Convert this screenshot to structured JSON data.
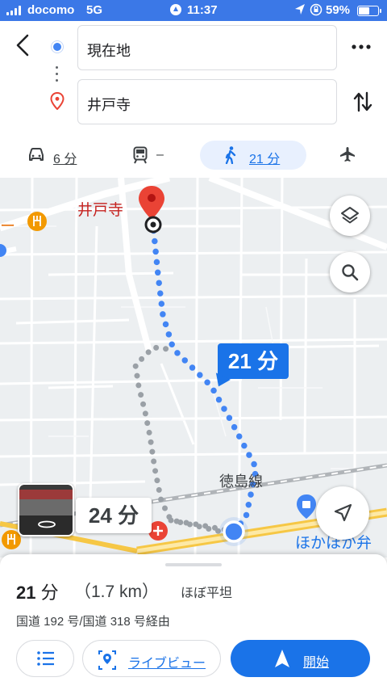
{
  "status_bar": {
    "carrier": "docomo",
    "network": "5G",
    "time": "11:37",
    "battery": "59%",
    "battery_level": 0.59
  },
  "header": {
    "origin": "現在地",
    "destination": "井戸寺"
  },
  "modes": [
    {
      "name": "car",
      "label": "6 分"
    },
    {
      "name": "transit",
      "label": "–"
    },
    {
      "name": "walk",
      "label": "21 分",
      "selected": true
    },
    {
      "name": "flight",
      "label": ""
    }
  ],
  "map": {
    "destination_label": "井戸寺",
    "route_time": "21 分",
    "alt_route_time": "24 分",
    "rail_line_label": "徳島線",
    "shop_label": "ほかほか弁",
    "side_label": "ー"
  },
  "sheet": {
    "duration_num": "21",
    "duration_unit": "分",
    "distance": "（1.7 km）",
    "terrain": "ほぼ平坦",
    "via": "国道 192 号/国道 318 号経由",
    "live_view_label": "ライブビュー",
    "start_label": "開始"
  },
  "colors": {
    "status_bar": "#3b78e7",
    "accent": "#1a73e8",
    "route_dots": "#4285f4",
    "alt_route_dots": "#9aa0a6",
    "pin_red": "#ea4335",
    "transit_line": "#f6c745"
  }
}
